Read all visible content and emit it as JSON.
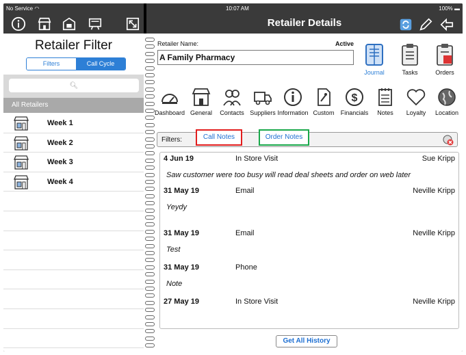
{
  "status_bar": {
    "carrier": "No Service",
    "time": "10:07 AM",
    "battery": "100%"
  },
  "left_pane": {
    "title": "Retailer Filter",
    "segments": [
      "Filters",
      "Call Cycle"
    ],
    "selected_segment": "Call Cycle",
    "search_placeholder": "",
    "section_header": "All Retailers",
    "weeks": [
      "Week 1",
      "Week 2",
      "Week 3",
      "Week 4"
    ]
  },
  "header": {
    "title": "Retailer Details"
  },
  "retailer": {
    "name_label": "Retailer Name:",
    "name_value": "A Family Pharmacy",
    "status": "Active"
  },
  "top_tools": [
    "Journal",
    "Tasks",
    "Orders"
  ],
  "tools": [
    "Dashboard",
    "General",
    "Contacts",
    "Suppliers",
    "Information",
    "Custom",
    "Financials",
    "Notes",
    "Loyalty",
    "Location"
  ],
  "filters": {
    "label": "Filters:",
    "call_notes": "Call Notes",
    "order_notes": "Order Notes"
  },
  "notes": [
    {
      "date": "4 Jun 19",
      "type": "In Store Visit",
      "user": "Sue Kripp",
      "text": "Saw customer were too busy will read deal sheets and order on web later"
    },
    {
      "date": "31 May 19",
      "type": "Email",
      "user": "Neville Kripp",
      "text": "Yeydy"
    },
    {
      "date": "31 May 19",
      "type": "Email",
      "user": "Neville Kripp",
      "text": "Test"
    },
    {
      "date": "31 May 19",
      "type": "Phone",
      "user": "",
      "text": "Note"
    },
    {
      "date": "27 May 19",
      "type": "In Store Visit",
      "user": "Neville Kripp",
      "text": ""
    }
  ],
  "history_button": "Get All History",
  "colors": {
    "accent": "#2d7fd6",
    "call_notes_border": "#e21d1d",
    "order_notes_border": "#19a84a",
    "bar": "#3a3a3a"
  }
}
